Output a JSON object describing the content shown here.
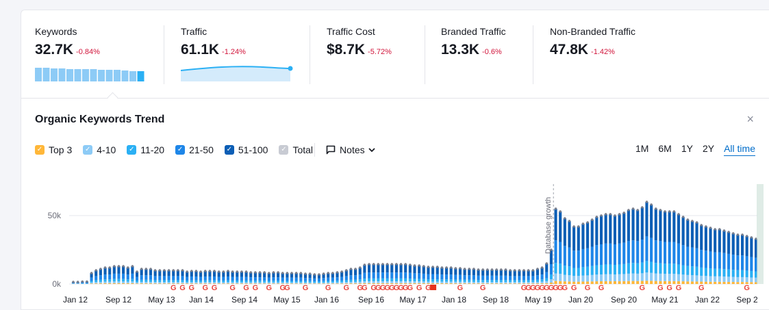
{
  "metrics": [
    {
      "label": "Keywords",
      "value": "32.7K",
      "delta": "-0.84%"
    },
    {
      "label": "Traffic",
      "value": "61.1K",
      "delta": "-1.24%"
    },
    {
      "label": "Traffic Cost",
      "value": "$8.7K",
      "delta": "-5.72%"
    },
    {
      "label": "Branded Traffic",
      "value": "13.3K",
      "delta": "-0.6%"
    },
    {
      "label": "Non-Branded Traffic",
      "value": "47.8K",
      "delta": "-1.42%"
    }
  ],
  "trend": {
    "title": "Organic Keywords Trend",
    "close": "×",
    "legend": [
      {
        "label": "Top 3",
        "color": "#ffb739",
        "checked": true
      },
      {
        "label": "4-10",
        "color": "#8dcbf6",
        "checked": true
      },
      {
        "label": "11-20",
        "color": "#2bb0f4",
        "checked": true
      },
      {
        "label": "21-50",
        "color": "#1e86e8",
        "checked": true
      },
      {
        "label": "51-100",
        "color": "#0c5eb5",
        "checked": true
      },
      {
        "label": "Total",
        "color": "#c8cbd3",
        "checked": true
      }
    ],
    "notes_label": "Notes",
    "ranges": [
      "1M",
      "6M",
      "1Y",
      "2Y",
      "All time"
    ],
    "active_range": "All time"
  },
  "chart_data": {
    "type": "bar",
    "stacked": true,
    "yticks": [
      "50k",
      "0k"
    ],
    "ylim": [
      0,
      70000
    ],
    "xticks": [
      "Jan 12",
      "Sep 12",
      "May 13",
      "Jan 14",
      "Sep 14",
      "May 15",
      "Jan 16",
      "Sep 16",
      "May 17",
      "Jan 18",
      "Sep 18",
      "May 19",
      "Jan 20",
      "Sep 20",
      "May 21",
      "Jan 22",
      "Sep 2"
    ],
    "annotation": "Database growth",
    "series_names": [
      "Top 3",
      "4-10",
      "11-20",
      "21-50",
      "51-100"
    ],
    "total_keywords": [
      1500,
      1500,
      1800,
      1800,
      8000,
      10000,
      11000,
      12000,
      12000,
      13000,
      13000,
      13000,
      12000,
      13000,
      9000,
      11000,
      11000,
      11000,
      10000,
      10000,
      10000,
      10000,
      10000,
      10000,
      10000,
      9000,
      9500,
      9500,
      9000,
      9500,
      9500,
      9500,
      9000,
      9000,
      9500,
      9000,
      9000,
      9000,
      9000,
      8500,
      8500,
      8500,
      8500,
      8000,
      8500,
      8500,
      8000,
      8000,
      8000,
      8000,
      8000,
      7500,
      7500,
      7000,
      7000,
      7500,
      8000,
      8000,
      8500,
      9000,
      10000,
      11000,
      11000,
      12000,
      14000,
      14500,
      14500,
      14500,
      14500,
      14500,
      14500,
      14500,
      14500,
      14500,
      14000,
      13500,
      13500,
      13000,
      12500,
      12500,
      12500,
      12000,
      12000,
      12000,
      11500,
      11500,
      11000,
      11000,
      11000,
      10500,
      10500,
      10500,
      10500,
      10500,
      10500,
      10500,
      10000,
      10000,
      10000,
      10000,
      10000,
      10000,
      11000,
      12000,
      15000,
      25000,
      55000,
      53000,
      48000,
      46000,
      42000,
      42000,
      44000,
      45000,
      47000,
      49000,
      50000,
      51000,
      51000,
      50000,
      51000,
      52000,
      54000,
      55000,
      54000,
      56000,
      60000,
      58000,
      55000,
      54000,
      53000,
      53000,
      53000,
      51000,
      49000,
      47000,
      46000,
      45000,
      43000,
      42000,
      41000,
      40000,
      40000,
      39000,
      38000,
      37000,
      36000,
      36000,
      35000,
      34000,
      33000
    ],
    "segment_share": {
      "Top 3": 0.04,
      "4-10": 0.1,
      "11-20": 0.14,
      "21-50": 0.3,
      "51-100": 0.42
    }
  }
}
